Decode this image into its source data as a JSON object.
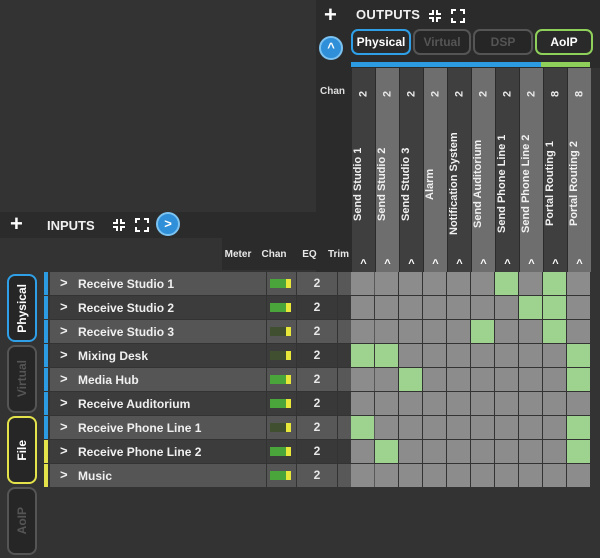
{
  "outputs": {
    "title": "OUTPUTS",
    "tabs": [
      {
        "label": "Physical",
        "state": "active"
      },
      {
        "label": "Virtual",
        "state": "disabled"
      },
      {
        "label": "DSP",
        "state": "disabled"
      },
      {
        "label": "AoIP",
        "state": "active"
      }
    ],
    "chan_label": "Chan",
    "columns": [
      {
        "name": "Send Studio 1",
        "chan": "2"
      },
      {
        "name": "Send Studio 2",
        "chan": "2"
      },
      {
        "name": "Send Studio 3",
        "chan": "2"
      },
      {
        "name": "Alarm",
        "chan": "2"
      },
      {
        "name": "Notification System",
        "chan": "2"
      },
      {
        "name": "Send Auditorium",
        "chan": "2"
      },
      {
        "name": "Send Phone Line 1",
        "chan": "2"
      },
      {
        "name": "Send Phone Line 2",
        "chan": "2"
      },
      {
        "name": "Portal Routing 1",
        "chan": "8"
      },
      {
        "name": "Portal Routing 2",
        "chan": "8"
      }
    ],
    "col_caret": "^"
  },
  "inputs": {
    "title": "INPUTS",
    "headers": {
      "meter": "Meter",
      "chan": "Chan",
      "eq": "EQ",
      "trim": "Trim"
    },
    "side_tabs": [
      {
        "label": "Physical",
        "state": "active"
      },
      {
        "label": "Virtual",
        "state": "disabled"
      },
      {
        "label": "File",
        "state": "active"
      },
      {
        "label": "AoIP",
        "state": "disabled"
      }
    ],
    "rows": [
      {
        "name": "Receive Studio 1",
        "chan": "2",
        "trim": "",
        "source": "physical",
        "meter": "active",
        "routes": [
          6,
          8
        ]
      },
      {
        "name": "Receive Studio 2",
        "chan": "2",
        "trim": "",
        "source": "physical",
        "meter": "active",
        "routes": [
          7,
          8
        ]
      },
      {
        "name": "Receive Studio 3",
        "chan": "2",
        "trim": "",
        "source": "physical",
        "meter": "weak",
        "routes": [
          5,
          8
        ]
      },
      {
        "name": "Mixing Desk",
        "chan": "2",
        "trim": "mute",
        "source": "physical",
        "meter": "weak",
        "routes": [
          0,
          1,
          9
        ]
      },
      {
        "name": "Media Hub",
        "chan": "2",
        "trim": "",
        "source": "physical",
        "meter": "active",
        "routes": [
          2,
          9
        ]
      },
      {
        "name": "Receive Auditorium",
        "chan": "2",
        "trim": "",
        "source": "physical",
        "meter": "active",
        "routes": []
      },
      {
        "name": "Receive Phone Line 1",
        "chan": "2",
        "trim": "mute",
        "source": "physical",
        "meter": "weak",
        "routes": [
          0,
          9
        ]
      },
      {
        "name": "Receive Phone Line 2",
        "chan": "2",
        "trim": "",
        "source": "file",
        "meter": "active",
        "routes": [
          1,
          9
        ]
      },
      {
        "name": "Music",
        "chan": "2",
        "trim": "",
        "source": "file",
        "meter": "active",
        "routes": []
      }
    ]
  },
  "icons": {
    "add": "plus-icon",
    "collapse": "compress-icon",
    "expand": "expand-icon",
    "scroll_up": "chevron-up-icon",
    "scroll_right": "chevron-right-icon",
    "row_expand": "chevron-right-icon",
    "mute": "speaker-mute-icon"
  },
  "colors": {
    "physical": "#2d9be2",
    "aoip": "#8fd05a",
    "file": "#e3e24a",
    "route_on": "#9ed28f",
    "route_off": "#8c8c8c"
  }
}
